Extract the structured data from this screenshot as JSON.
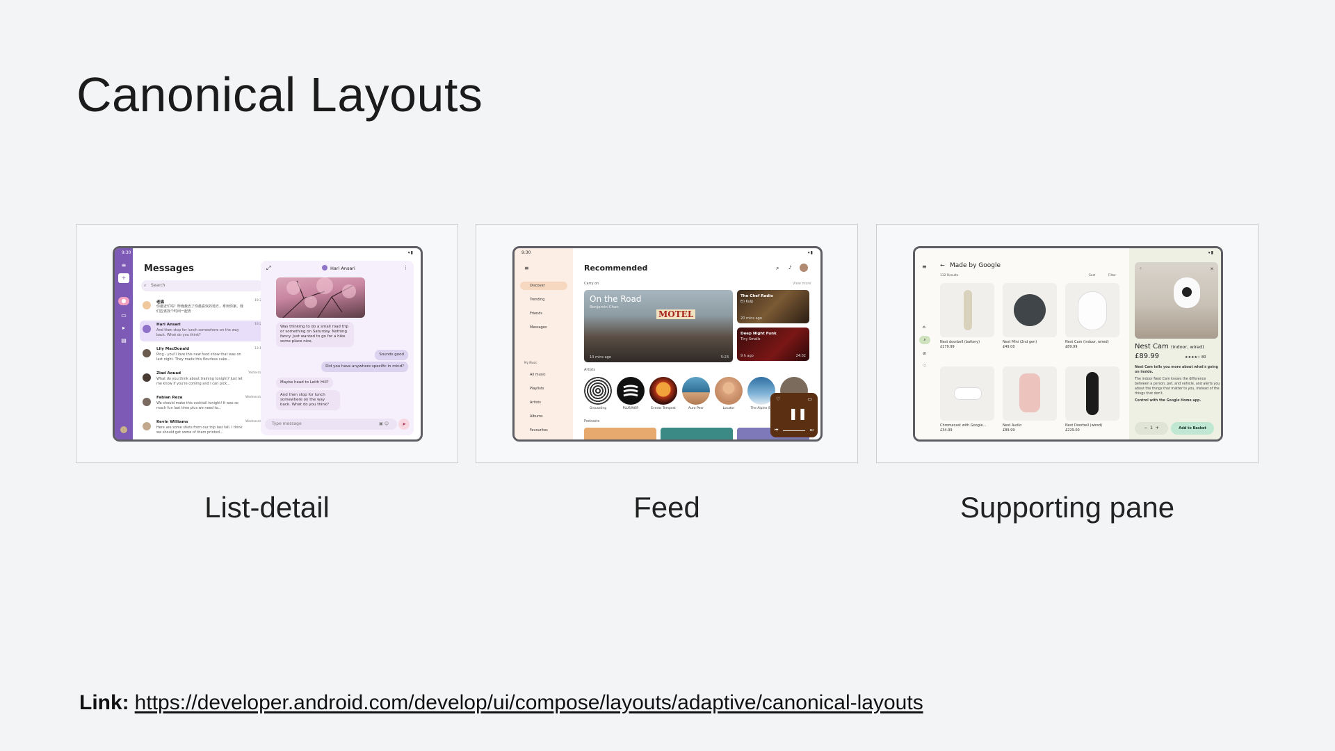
{
  "page": {
    "title": "Canonical Layouts",
    "link_label": "Link:",
    "link_url": "https://developer.android.com/develop/ui/compose/layouts/adaptive/canonical-layouts"
  },
  "captions": [
    "List-detail",
    "Feed",
    "Supporting pane"
  ],
  "status_bar": {
    "time": "9:30"
  },
  "list_detail": {
    "title": "Messages",
    "search_placeholder": "Search",
    "contact": "Hari Ansari",
    "conversations": [
      {
        "name": "老猫",
        "time": "19:27",
        "preview": "你最近忙吗？昨晚我去了你最喜欢的地方，拿到你家。我们应该找个时间一起去"
      },
      {
        "name": "Hari Ansari",
        "time": "19:20",
        "preview": "And then stop for lunch somewhere on the way back. What do you think?"
      },
      {
        "name": "Lily MacDonald",
        "time": "13:14",
        "preview": "Ping - you'll love this new food show that was on last night. They made this flourless cake..."
      },
      {
        "name": "Ziad Aouad",
        "time": "Yesterday",
        "preview": "What do you think about training tonight? Just let me know if you're coming and I can pick..."
      },
      {
        "name": "Fabian Reza",
        "time": "Wednesday",
        "preview": "We should make this cocktail tonight! It was so much fun last time plus we need to..."
      },
      {
        "name": "Kevin Williams",
        "time": "Wednesday",
        "preview": "Here are some shots from our trip last fall. I think we should get some of them printed..."
      }
    ],
    "messages": [
      "Was thinking to do a small road trip or something on Saturday. Nothing fancy. Just wanted to go for a hike some place nice.",
      "Sounds good",
      "Did you have anywhere specific in mind?",
      "Maybe head to Leith Hill?",
      "And then stop for lunch somewhere on the way back. What do you think?"
    ],
    "input_placeholder": "Type message"
  },
  "feed": {
    "nav": [
      "Discover",
      "Trending",
      "Friends",
      "Messages"
    ],
    "music_header": "My Music",
    "music_nav": [
      "All music",
      "Playlists",
      "Artists",
      "Albums",
      "Favourites"
    ],
    "title": "Recommended",
    "carry_on": "Carry on",
    "view_more": "View more",
    "hero": {
      "title": "On the Road",
      "artist": "Benjamin Chan",
      "ago": "13 mins ago",
      "duration": "5:23",
      "sign": "MOTEL"
    },
    "side_cards": [
      {
        "title": "The Chef Radio",
        "subtitle": "Eli Kulp",
        "ago": "20 mins ago",
        "duration": ""
      },
      {
        "title": "Deep Night Funk",
        "subtitle": "Tiny Smalls",
        "ago": "9 h ago",
        "duration": "24:02"
      }
    ],
    "artists_header": "Artists",
    "artists": [
      "Grouseling",
      "PLUS/NOR",
      "Events Tempest",
      "Aura Peer",
      "Locator",
      "The Alpine Sp"
    ],
    "podcasts_header": "Podcasts"
  },
  "supporting": {
    "title": "Made by Google",
    "results": "112 Results",
    "sort": "Sort",
    "filter": "Filter",
    "products": [
      {
        "name": "Nest doorbell (battery)",
        "price": "£179.99",
        "reviews": "917"
      },
      {
        "name": "Nest Mini (2nd gen)",
        "price": "£49.00",
        "reviews": "885"
      },
      {
        "name": "Nest Cam (indoor, wired)",
        "price": "£89.99",
        "reviews": ""
      },
      {
        "name": "Chromecast with Google...",
        "price": "£34.99",
        "reviews": ""
      },
      {
        "name": "Nest Audio",
        "price": "£89.99",
        "reviews": ""
      },
      {
        "name": "Nest Doorbell (wired)",
        "price": "£229.00",
        "reviews": ""
      }
    ],
    "detail": {
      "title": "Nest Cam",
      "variant": "(indoor, wired)",
      "price": "£89.99",
      "reviews": "80",
      "tagline": "Nest Cam tells you more about what's going on inside.",
      "description": "The indoor Nest Cam knows the difference between a person, pet, and vehicle, and alerts you about the things that matter to you, instead of the things that don't.",
      "control": "Control with the Google Home app.",
      "quantity": "1",
      "basket": "Add to Basket"
    }
  },
  "colors": {
    "rail": "#7d5ab5",
    "feed_nav": "#fceee4",
    "pane": "#eef0e4"
  }
}
